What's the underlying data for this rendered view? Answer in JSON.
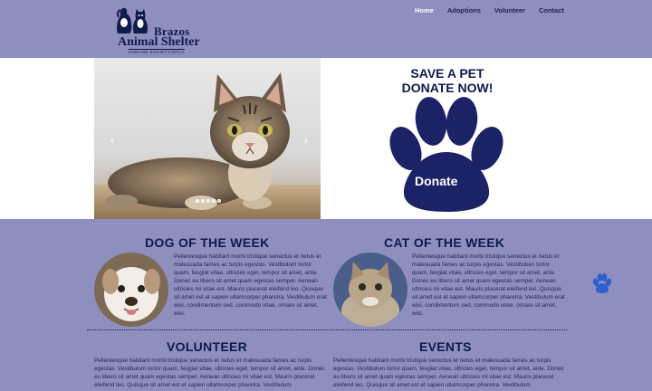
{
  "logo": {
    "line1": "Brazos",
    "line2": "Animal Shelter",
    "line3": "HUMANE SOCIETY/SPCA"
  },
  "nav": {
    "items": [
      "Home",
      "Adoptions",
      "Volunteer",
      "Contact"
    ],
    "active": "Home"
  },
  "hero": {
    "slider_prev": "‹",
    "slider_next": "›",
    "dot_count": 5,
    "active_dot": 1,
    "donate_line1": "SAVE A PET",
    "donate_line2": "DONATE NOW!",
    "donate_button": "Donate"
  },
  "dog": {
    "title": "DOG OF THE WEEK",
    "text": "Pellentesque habitant morbi tristique senectus et netus et malesuada fames ac turpis egestas. Vestibulum tortor quam, feugiat vitae, ultricies eget, tempor sit amet, ante. Donec eu libero sit amet quam egestas semper. Aenean ultricies mi vitae est. Mauris placerat eleifend leo. Quisque sit amet est et sapien ullamcorper pharetra. Vestibulum erat wisi, condimentum sed, commodo vitae, ornare sit amet, wisi."
  },
  "cat": {
    "title": "CAT OF THE WEEK",
    "text": "Pellentesque habitant morbi tristique senectus et netus et malesuada fames ac turpis egestas. Vestibulum tortor quam, feugiat vitae, ultricies eget, tempor sit amet, ante. Donec eu libero sit amet quam egestas semper. Aenean ultricies mi vitae est. Mauris placerat eleifend leo. Quisque sit amet est et sapien ullamcorper pharetra. Vestibulum erat wisi, condimentum sed, commodo vitae, ornare sit amet, wisi."
  },
  "volunteer": {
    "title": "VOLUNTEER",
    "text": "Pellentesque habitant morbi tristique senectus et netus et malesuada fames ac turpis egestas. Vestibulum tortor quam, feugiat vitae, ultricies eget, tempor sit amet, ante. Donec eu libero sit amet quam egestas semper. Aenean ultricies mi vitae est. Mauris placerat eleifend leo. Quisque sit amet est et sapien ullamcorper pharetra. Vestibulum"
  },
  "events": {
    "title": "EVENTS",
    "text": "Pellentesque habitant morbi tristique senectus et netus et malesuada fames ac turpis egestas. Vestibulum tortor quam, feugiat vitae, ultricies eget, tempor sit amet, ante. Donec eu libero sit amet quam egestas semper. Aenean ultricies mi vitae est. Mauris placerat eleifend leo. Quisque sit amet est et sapien ullamcorper pharetra. Vestibulum"
  },
  "colors": {
    "background": "#8e8fbf",
    "navy": "#0f1a4d",
    "nav_active": "#ffffff",
    "paw_blue": "#2f5fd0"
  },
  "icons": {
    "side_widget": "paw-icon"
  }
}
